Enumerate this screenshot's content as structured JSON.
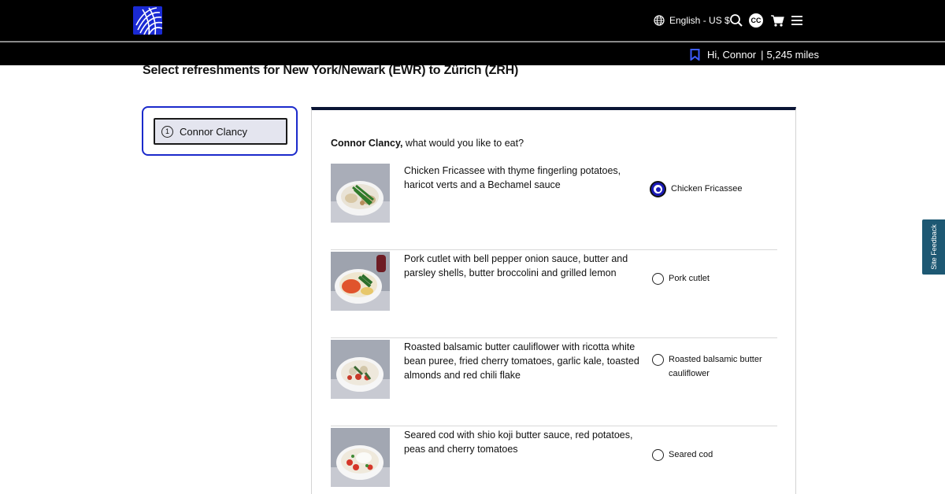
{
  "header": {
    "logo_name": "united-globe-logo",
    "language": "English - US $",
    "avatar_initials": "CC",
    "greeting": "Hi, Connor",
    "separator": "|",
    "miles": "5,245 miles"
  },
  "page_title": "Select refreshments for New York/Newark (EWR) to Zürich (ZRH)",
  "passenger": {
    "number": "1",
    "name": "Connor Clancy"
  },
  "prompt": {
    "name": "Connor Clancy,",
    "question": " what would you like to eat?"
  },
  "meals": [
    {
      "description": "Chicken Fricassee with thyme fingerling potatoes, haricot verts and a Bechamel sauce",
      "option": "Chicken Fricassee",
      "selected": true
    },
    {
      "description": "Pork cutlet with bell pepper onion sauce, butter and parsley shells, butter broccolini and grilled lemon",
      "option": "Pork cutlet",
      "selected": false
    },
    {
      "description": "Roasted balsamic butter cauliflower with ricotta white bean puree, fried cherry tomatoes, garlic kale, toasted almonds and red chili flake",
      "option": "Roasted balsamic butter cauliflower",
      "selected": false
    },
    {
      "description": "Seared cod with shio koji butter sauce, red potatoes, peas and cherry tomatoes",
      "option": "Seared cod",
      "selected": false
    }
  ],
  "feedback_tab": "Site Feedback",
  "colors": {
    "topbar": "#000000",
    "accent_blue": "#1b2acb",
    "panel_top": "#0b1535",
    "feedback": "#1d5873"
  }
}
